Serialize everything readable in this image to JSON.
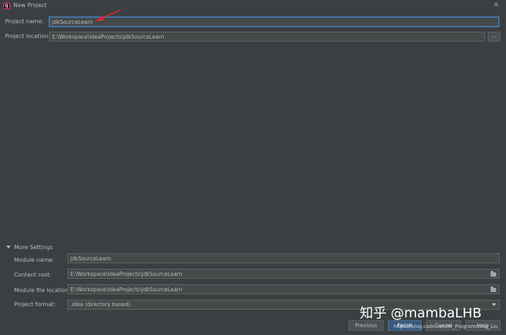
{
  "window": {
    "title": "New Project"
  },
  "project": {
    "name_label": "Project name:",
    "name_value": "jdkSourceLearn",
    "location_label": "Project location:",
    "location_value": "E:\\Workspace\\ideaProjects\\jdkSourceLearn",
    "browse_label": "..."
  },
  "more_settings": {
    "toggle_label": "More Settings",
    "module_name_label": "Module name:",
    "module_name_value": "jdkSourceLearn",
    "content_root_label": "Content root:",
    "content_root_value": "E:\\Workspace\\IdeaProjects\\jdkSourceLearn",
    "module_file_label": "Module file location:",
    "module_file_value": "E:\\Workspace\\IdeaProjects\\jdkSourceLearn",
    "project_format_label": "Project format:",
    "project_format_value": ".idea (directory based)"
  },
  "buttons": {
    "previous": "Previous",
    "finish": "Finish",
    "cancel": "Cancel",
    "help": "Help"
  },
  "watermark": {
    "zhihu": "知乎 @mambaLHB",
    "csdn": "https://blog.csdn.net/Mr_Programming_Liu"
  },
  "colors": {
    "background": "#3c3f41",
    "field_bg": "#45494a",
    "focus_border": "#4a88c7",
    "annotation_arrow": "#e0282e",
    "primary_button": "#365880"
  }
}
